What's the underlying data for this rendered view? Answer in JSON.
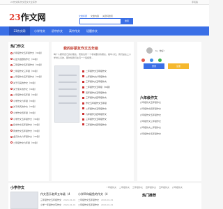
{
  "topbar": {
    "left": "23作文网-作文范文大全写作",
    "right": "手机版"
  },
  "header": {
    "logo_num": "23",
    "logo_text": "作文网",
    "search_tabs": [
      "文章标题",
      "文章内容",
      "关键词搜索"
    ],
    "search_placeholder": "请输入关键词",
    "search_button": "搜索"
  },
  "nav": [
    "23作文网",
    "小学作文",
    "初中作文",
    "高中作文",
    "话题作文"
  ],
  "left_panel": {
    "title": "热门作文",
    "items": [
      "六年级作文五年级作文（30篇）",
      "以爱为话题的作文（30篇）",
      "三年级作文五年级作文（30篇）",
      "二年级作文三年级（30篇）",
      "二年级作文五年级作文（30篇）",
      "关于月亮的作文（30篇）",
      "关于家乡的作文（30篇）",
      "二年级作文五年级（30篇）",
      "小学作文六年级（30篇）",
      "关于春天的作文（30篇）",
      "小学作文四年级（30篇）",
      "小学作文五年级作文（30篇）",
      "初中作文五年级作文（30篇）",
      "周末作文五年级作文（30篇）",
      "金元作文六年级作文（30篇）",
      "二年级作文六年级（30篇）"
    ]
  },
  "mid_panel": {
    "hero_title": "我的好朋友作文五年级",
    "desc": "每个人都有自己的好朋友，而我也有一个非常要好的朋友，她叫小红。我们是在上小学时认识的，那时候我们在同一个班级里...",
    "items": [
      "二年级作文五年级作文",
      "二年级作文六年级作文",
      "三年级作文五年级作文",
      "二年级作文五年级（30篇）",
      "四年级作文五年级作文",
      "三年级作文四年级作文",
      "作文五年级作文五年级",
      "二年级作文五年级作文",
      "六年级作文四年级作文",
      "三年级作文五年级作文",
      "三年级作文四年级作文"
    ]
  },
  "right_panel": {
    "user": "hi，你好!",
    "icons": [
      "weibo-icon",
      "qq-icon",
      "wechat-icon"
    ],
    "login": "登录",
    "register": "注册",
    "list_title": "六年级作文",
    "items": [
      "六年级作文五年级作文",
      "六年级作文四年级作文",
      "六年级作文五年级作文",
      "六年级作文三年级作文",
      "六年级作文二年级作文",
      "六年级作文五年级作文"
    ]
  },
  "section2": {
    "title": "小学作文",
    "tabs": [
      "一年级作文",
      "二年级作文",
      "三年级作文",
      "四年级作文",
      "五年级作文",
      "六年级作文"
    ],
    "hot_title": "热门推荐",
    "block1_title": "作文音乐老师五年级（4",
    "block2_title": "小学四年级鱼的作文（4",
    "block1_items": [
      {
        "t": "三年级作文五年级作文",
        "d": "2024-01-01"
      },
      {
        "t": "小学一年级作文写作文",
        "d": "2024-01-01"
      }
    ],
    "block2_items": [
      {
        "t": "二年级作文五年级作文",
        "d": "2024-01-01"
      },
      {
        "t": "二年级作文五年级作文",
        "d": "2024-01-01"
      }
    ]
  },
  "colors": {
    "accent": "#3a6fe6",
    "brand_red": "#e23c2c",
    "gold": "#f5b82e"
  }
}
